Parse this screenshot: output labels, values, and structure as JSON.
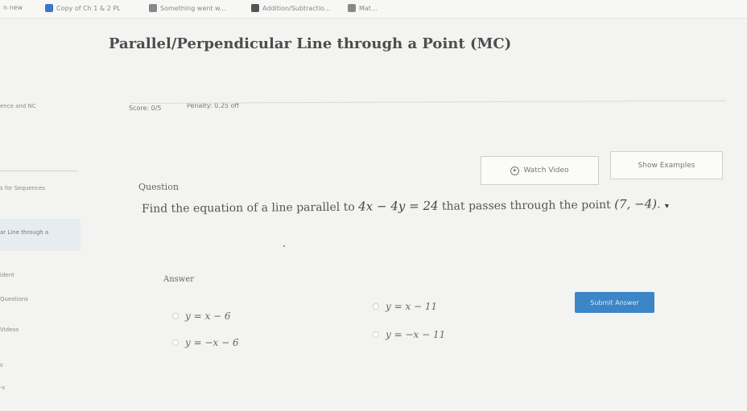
{
  "bookmarks": [
    {
      "label": "n new",
      "icon": "none"
    },
    {
      "label": "Copy of Ch 1 & 2 PL",
      "icon": "doc-icon"
    },
    {
      "label": "Something went w...",
      "icon": "tab-icon"
    },
    {
      "label": "Addition/Subtractio...",
      "icon": "doc-icon-dark"
    },
    {
      "label": "Mat...",
      "icon": "tab-icon"
    }
  ],
  "page": {
    "title": "Parallel/Perpendicular Line through a Point (MC)"
  },
  "sidebar": {
    "items": [
      {
        "label": "ence and NC"
      },
      {
        "label": "s for Sequences"
      },
      {
        "label": "ar Line through a"
      },
      {
        "label": "ident"
      },
      {
        "label": "Questions"
      },
      {
        "label": "Videos"
      },
      {
        "label": "s"
      },
      {
        "label": "-s"
      }
    ]
  },
  "status": {
    "score": "Score: 0/5",
    "penalty": "Penalty: 0.25 off"
  },
  "buttons": {
    "watch_video": "Watch Video",
    "show_examples": "Show Examples",
    "submit": "Submit Answer"
  },
  "question": {
    "heading": "Question",
    "text_before": "Find the equation of a line parallel to",
    "equation": "4x − 4y = 24",
    "text_middle": "that passes through the point",
    "point": "(7, −4)",
    "text_end": "."
  },
  "answer": {
    "heading": "Answer",
    "choices": [
      "y = x − 6",
      "y = x − 11",
      "y = −x − 6",
      "y = −x − 11"
    ]
  }
}
